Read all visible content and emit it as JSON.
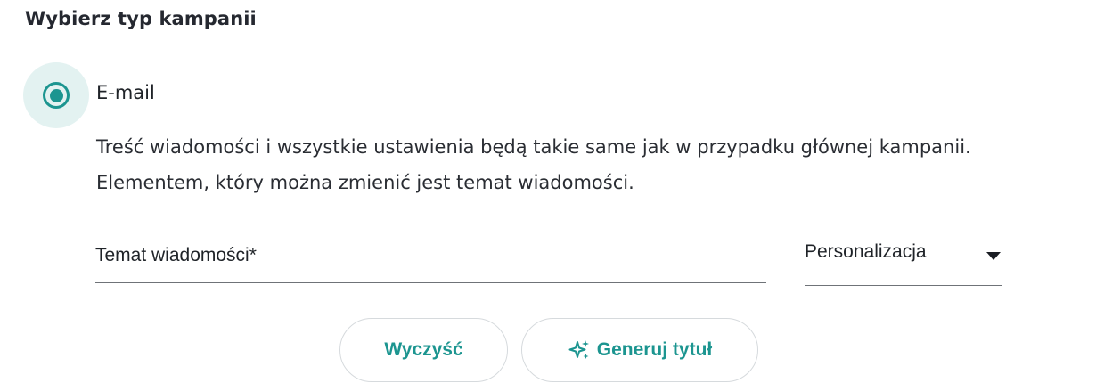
{
  "section": {
    "title": "Wybierz typ kampanii"
  },
  "campaign_type": {
    "option_label": "E-mail",
    "selected": true,
    "description": "Treść wiadomości i wszystkie ustawienia będą takie same jak w przypadku głównej kampanii. Elementem, który można zmienić jest temat wiadomości."
  },
  "subject_field": {
    "label": "Temat wiadomości*",
    "value": ""
  },
  "personalization": {
    "label": "Personalizacja",
    "icon": "caret-down-icon"
  },
  "buttons": {
    "clear_label": "Wyczyść",
    "generate_label": "Generuj tytuł",
    "generate_icon": "sparkle-icon"
  },
  "colors": {
    "accent": "#1c9590",
    "radio_halo": "#e3f2f1",
    "underline": "#6f7378",
    "button_border": "#d6dadd"
  }
}
